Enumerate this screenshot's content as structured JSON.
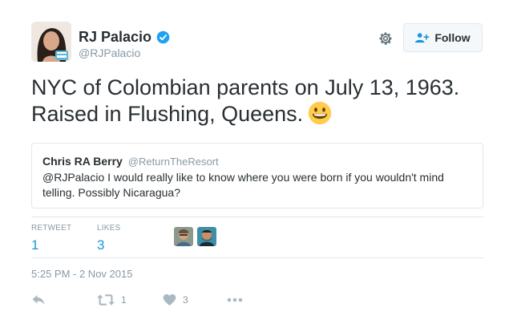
{
  "author": {
    "name": "RJ Palacio",
    "handle": "@RJPalacio",
    "avatar_icon": "author-avatar",
    "verified_icon": "verified-badge-icon"
  },
  "header": {
    "settings_icon": "gear-icon",
    "follow_label": "Follow",
    "follow_icon": "add-user-icon"
  },
  "tweet": {
    "text": "NYC of Colombian parents on July 13, 1963. Raised in Flushing, Queens.",
    "emoji_icon": "grinning-face-icon"
  },
  "quoted": {
    "author": "Chris RA Berry",
    "handle": "@ReturnTheResort",
    "text": "@RJPalacio I would really like to know where you were born if you wouldn't mind telling. Possibly Nicaragua?"
  },
  "stats": {
    "retweet_label": "RETWEET",
    "retweet_count": "1",
    "likes_label": "LIKES",
    "likes_count": "3"
  },
  "timestamp": "5:25 PM - 2 Nov 2015",
  "actions": {
    "retweet_count": "1",
    "like_count": "3"
  },
  "colors": {
    "accent": "#1b95e0",
    "text": "#292f33",
    "muted": "#8899a6",
    "border": "#e1e8ed"
  }
}
